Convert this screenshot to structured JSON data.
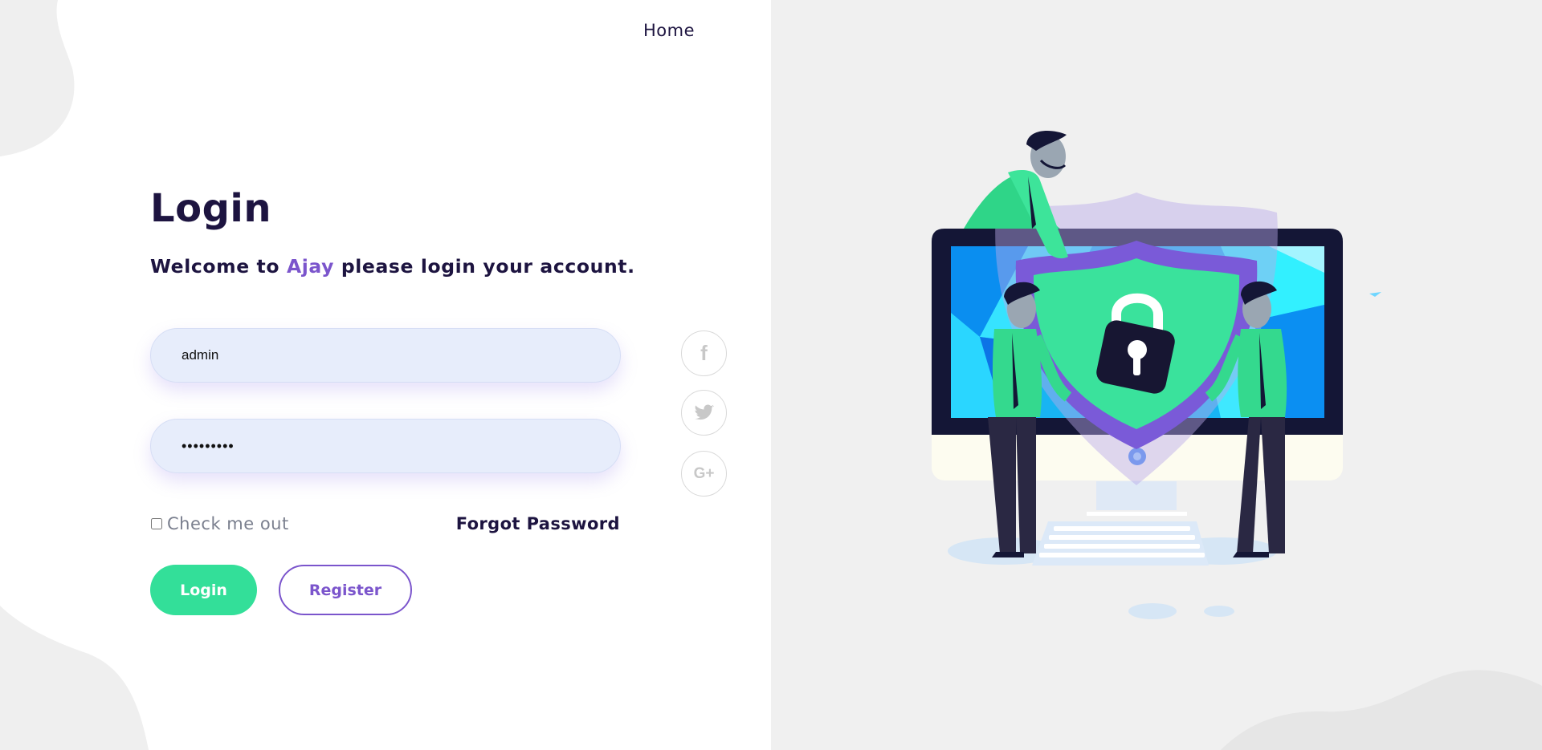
{
  "nav": {
    "home_label": "Home"
  },
  "login": {
    "title": "Login",
    "welcome_prefix": "Welcome to",
    "brand": "Ajay",
    "welcome_suffix": "please login your account.",
    "username_value": "admin",
    "password_value": "•••••••••",
    "remember_label": "Check me out",
    "forgot_label": "Forgot Password",
    "login_button": "Login",
    "register_button": "Register"
  },
  "social": [
    {
      "icon": "facebook-icon",
      "glyph": "f"
    },
    {
      "icon": "twitter-icon",
      "glyph": "twitter-bird"
    },
    {
      "icon": "google-plus-icon",
      "glyph": "G+"
    }
  ],
  "colors": {
    "primary_text": "#1d1440",
    "brand_purple": "#7b55cc",
    "accent_green": "#33df99",
    "input_bg": "#e7edfb",
    "right_bg": "#f0f0f0"
  },
  "illustration": {
    "name": "security-shield-illustration"
  }
}
